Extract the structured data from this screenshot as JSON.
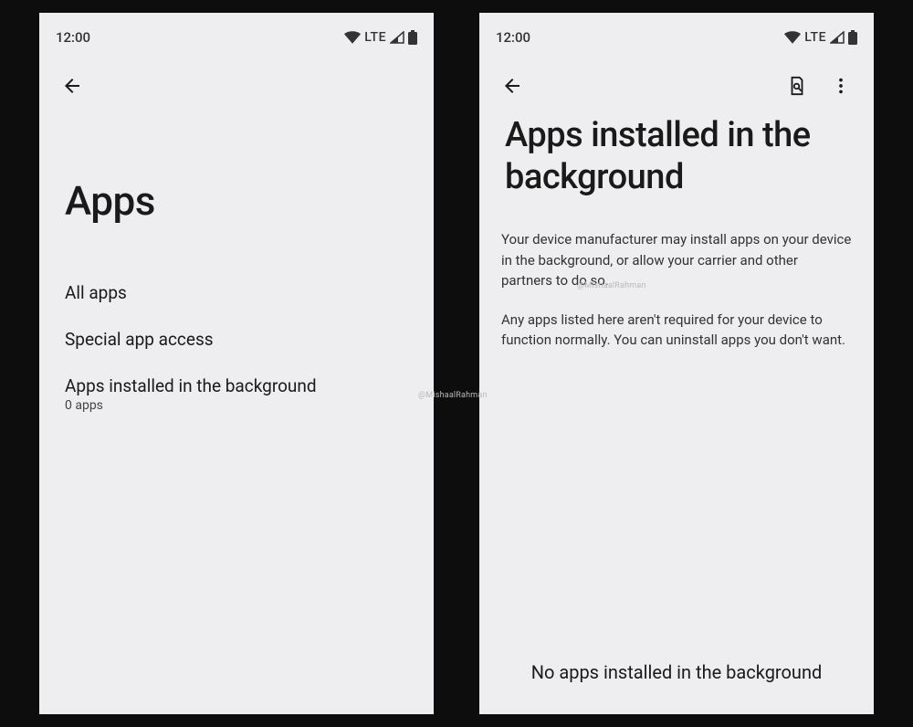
{
  "statusbar": {
    "time": "12:00",
    "network": "LTE"
  },
  "left": {
    "title": "Apps",
    "items": [
      {
        "title": "All apps",
        "sub": ""
      },
      {
        "title": "Special app access",
        "sub": ""
      },
      {
        "title": "Apps installed in the background",
        "sub": "0 apps"
      }
    ]
  },
  "right": {
    "title": "Apps installed in the background",
    "desc1": "Your device manufacturer may install apps on your device in the background, or allow your carrier and other partners to do so.",
    "desc2": "Any apps listed here aren't required for your device to function normally. You can uninstall apps you don't want.",
    "empty": "No apps installed in the background"
  },
  "watermark": "@MishaalRahman"
}
